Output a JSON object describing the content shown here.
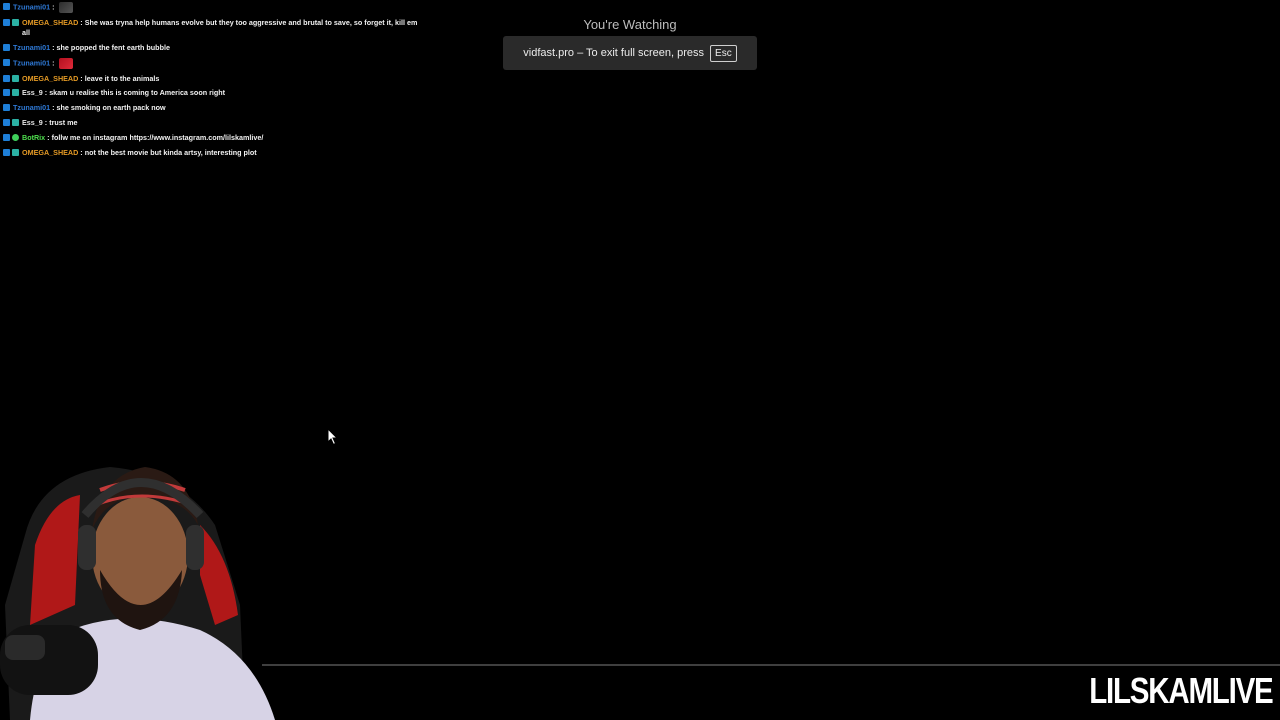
{
  "chat": {
    "messages": [
      {
        "badges": [
          "mod"
        ],
        "user": "Tzunami01",
        "color": "blue",
        "text": "",
        "emote": "dark"
      },
      {
        "badges": [
          "mod",
          "sub"
        ],
        "user": "OMEGA_SHEAD",
        "color": "orange",
        "text": "She was tryna help humans evolve but they too aggressive and brutal to save, so forget it, kill em all"
      },
      {
        "badges": [
          "mod"
        ],
        "user": "Tzunami01",
        "color": "blue",
        "text": "she popped the fent earth bubble"
      },
      {
        "badges": [
          "mod"
        ],
        "user": "Tzunami01",
        "color": "blue",
        "text": "",
        "emote": "red"
      },
      {
        "badges": [
          "mod",
          "sub"
        ],
        "user": "OMEGA_SHEAD",
        "color": "orange",
        "text": "leave it to the animals"
      },
      {
        "badges": [
          "mod",
          "sub"
        ],
        "user": "Ess_9",
        "color": "white",
        "text": "skam u realise this is coming to America soon right"
      },
      {
        "badges": [
          "mod"
        ],
        "user": "Tzunami01",
        "color": "blue",
        "text": "she smoking on earth pack now"
      },
      {
        "badges": [
          "mod",
          "sub"
        ],
        "user": "Ess_9",
        "color": "white",
        "text": "trust me"
      },
      {
        "badges": [
          "mod",
          "bot"
        ],
        "user": "BotRix",
        "color": "green",
        "text": "follw me on instagram https://www.instagram.com/lilskamlive/"
      },
      {
        "badges": [
          "mod",
          "sub"
        ],
        "user": "OMEGA_SHEAD",
        "color": "orange",
        "text": "not the best movie but kinda artsy, interesting plot"
      }
    ]
  },
  "overlay": {
    "watching_label": "You're Watching",
    "fullscreen_notice": "vidfast.pro – To exit full screen, press",
    "key_label": "Esc"
  },
  "brand": {
    "name": "LILSKAMLIVE"
  },
  "icons": {
    "cursor": "mouse-cursor-icon"
  }
}
